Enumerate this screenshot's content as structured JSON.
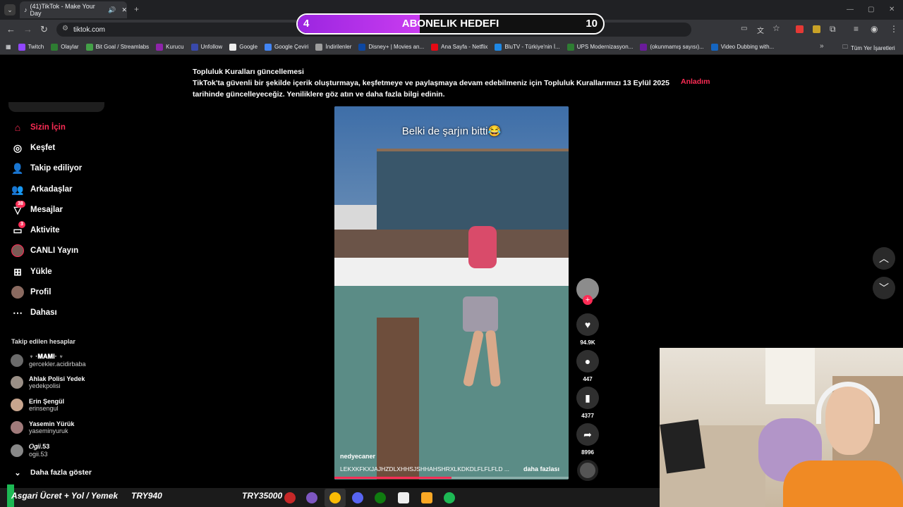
{
  "browser": {
    "tab_title": "(41)TikTok - Make Your Day",
    "url": "tiktok.com",
    "bookmarks": [
      {
        "label": "Twitch",
        "color": "#9146ff"
      },
      {
        "label": "Olaylar",
        "color": "#2e7d32"
      },
      {
        "label": "Bit Goal / Streamlabs",
        "color": "#43a047"
      },
      {
        "label": "Kurucu",
        "color": "#8e24aa"
      },
      {
        "label": "Unfollow",
        "color": "#3949ab"
      },
      {
        "label": "Google",
        "color": "#eeeeee"
      },
      {
        "label": "Google Çeviri",
        "color": "#4285f4"
      },
      {
        "label": "İndirilenler",
        "color": "#9e9e9e"
      },
      {
        "label": "Disney+ | Movies an...",
        "color": "#0d47a1"
      },
      {
        "label": "Ana Sayfa - Netflix",
        "color": "#e50914"
      },
      {
        "label": "BluTV - Türkiye'nin İ...",
        "color": "#1e88e5"
      },
      {
        "label": "UPS Modernizasyon...",
        "color": "#2e7d32"
      },
      {
        "label": "(okunmamış sayısı)...",
        "color": "#6a1b9a"
      },
      {
        "label": "Video Dubbing with...",
        "color": "#1565c0"
      }
    ],
    "all_bookmarks": "Tüm Yer İşaretleri"
  },
  "goal": {
    "current": "4",
    "title": "ABONELIK HEDEFI",
    "target": "10",
    "progress": 0.4
  },
  "notice": {
    "title": "Topluluk Kuralları güncellemesi",
    "line1": "TikTok'ta güvenli bir şekilde içerik oluşturmaya, keşfetmeye ve paylaşmaya devam edebilmeniz için Topluluk Kurallarımızı 13 Eylül 2025",
    "line2": "tarihinde güncelleyeceğiz. Yeniliklere göz atın ve daha fazla bilgi edinin.",
    "action": "Anladım"
  },
  "sidebar": {
    "items": [
      {
        "label": "Sizin İçin",
        "icon": "home-icon",
        "active": true
      },
      {
        "label": "Keşfet",
        "icon": "compass-icon"
      },
      {
        "label": "Takip ediliyor",
        "icon": "following-icon"
      },
      {
        "label": "Arkadaşlar",
        "icon": "friends-icon"
      },
      {
        "label": "Mesajlar",
        "icon": "messages-icon",
        "badge": "38"
      },
      {
        "label": "Aktivite",
        "icon": "activity-icon",
        "badge": "3"
      },
      {
        "label": "CANLI Yayın",
        "icon": "live-icon"
      },
      {
        "label": "Yükle",
        "icon": "upload-icon"
      },
      {
        "label": "Profil",
        "icon": "profile-icon"
      },
      {
        "label": "Dahası",
        "icon": "more-icon"
      }
    ],
    "following_title": "Takip edilen hesaplar",
    "accounts": [
      {
        "name": "♆ ·𝐌𝐀𝐌𝐢· ♆",
        "user": "gercekler.acidirbaba"
      },
      {
        "name": "Ahlak Polisi Yedek",
        "user": "yedekpolisi"
      },
      {
        "name": "Erin Şengül",
        "user": "erinsengul"
      },
      {
        "name": "Yasemin Yürük",
        "user": "yaseminyuruk"
      },
      {
        "name": "𝑂𝑔𝑖𝑖.53",
        "user": "ogii.53"
      }
    ],
    "show_more": "Daha fazla göster"
  },
  "video": {
    "caption_overlay": "Belki de şarjın bitti😂",
    "author": "nedyecaner",
    "description": "LEKXKFKXJAJHZDLXHHSJSHHAHSHRXLKDKDLFLFLFLD ...",
    "more": "daha fazlası",
    "progress": 0.5
  },
  "actions": {
    "likes": "94.9K",
    "comments": "447",
    "saves": "4377",
    "shares": "8996"
  },
  "ticker": {
    "text1": "Asgari Ücret + Yol / Yemek",
    "text2": "TRY940",
    "text3": "TRY35000"
  },
  "colors": {
    "accent": "#fe2c55",
    "goal_fill": "#b030e8"
  }
}
